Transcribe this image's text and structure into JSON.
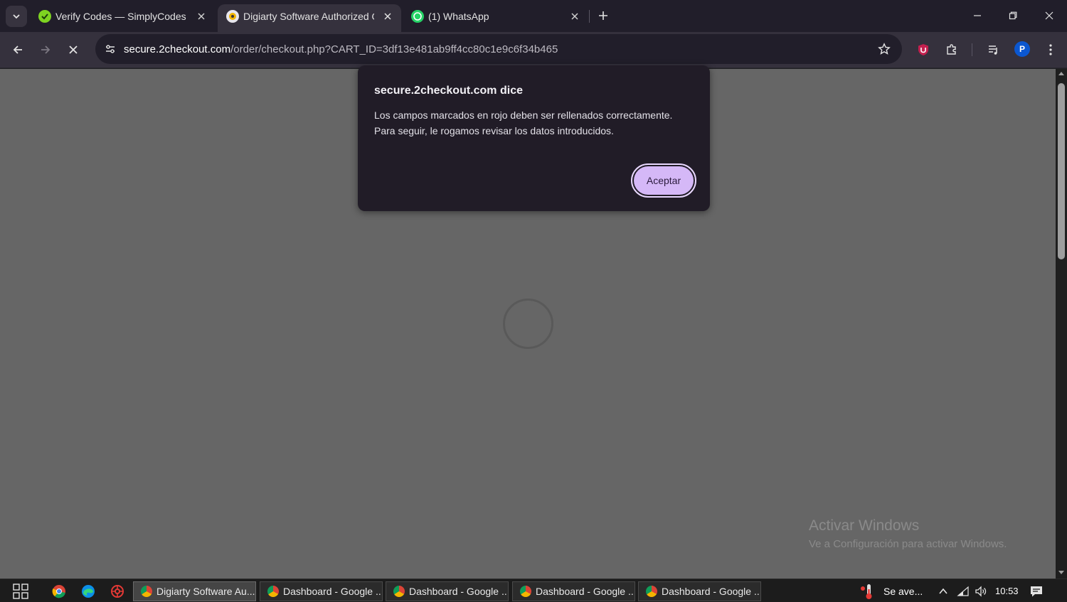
{
  "browser": {
    "tabs": [
      {
        "title": "Verify Codes — SimplyCodes",
        "active": false,
        "favicon": "simplycodes-icon"
      },
      {
        "title": "Digiarty Software Authorized O",
        "active": true,
        "favicon": "digiarty-icon"
      },
      {
        "title": "(1) WhatsApp",
        "active": false,
        "favicon": "whatsapp-icon"
      }
    ],
    "url_host": "secure.2checkout.com",
    "url_path": "/order/checkout.php?CART_ID=3df13e481ab9ff4cc80c1e9c6f34b465",
    "profile_initial": "P"
  },
  "dialog": {
    "title": "secure.2checkout.com dice",
    "message_lines": [
      "Los campos marcados en rojo deben ser rellenados correctamente.",
      "Para seguir, le rogamos revisar los datos introducidos."
    ],
    "ok_label": "Aceptar"
  },
  "watermark": {
    "title": "Activar Windows",
    "subtitle": "Ve a Configuración para activar Windows."
  },
  "taskbar": {
    "windows": [
      {
        "label": "Digiarty Software Au...",
        "active": true
      },
      {
        "label": "Dashboard - Google ...",
        "active": false
      },
      {
        "label": "Dashboard - Google ...",
        "active": false
      },
      {
        "label": "Dashboard - Google ...",
        "active": false
      },
      {
        "label": "Dashboard - Google ...",
        "active": false
      }
    ],
    "weather_text": "Se ave...",
    "clock": "10:53"
  },
  "colors": {
    "accent_button": "#d5b8f7",
    "page_overlay": "#666666",
    "tab_bar": "#211e2a"
  }
}
